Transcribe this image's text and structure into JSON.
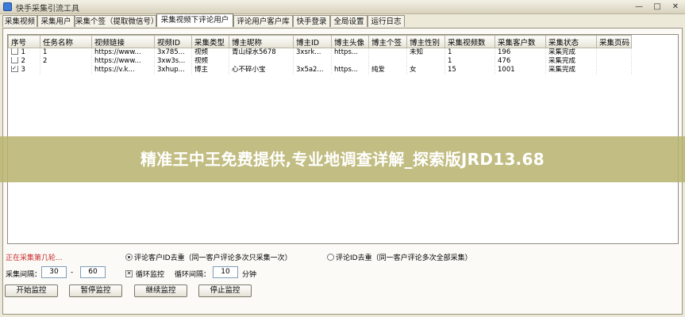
{
  "window": {
    "title": "快手采集引流工具",
    "min": "—",
    "max": "□",
    "close": "✕"
  },
  "tabs": [
    {
      "label": "采集视频"
    },
    {
      "label": "采集用户"
    },
    {
      "label": "采集个签（提取微信号）"
    },
    {
      "label": "采集视频下评论用户"
    },
    {
      "label": "评论用户客户库"
    },
    {
      "label": "快手登录"
    },
    {
      "label": "全局设置"
    },
    {
      "label": "运行日志"
    }
  ],
  "table": {
    "columns": [
      "序号",
      "任务名称",
      "视频链接",
      "视频ID",
      "采集类型",
      "博主昵称",
      "博主ID",
      "博主头像",
      "博主个签",
      "博主性别",
      "采集视频数",
      "采集客户数",
      "采集状态",
      "采集页码"
    ],
    "rows": [
      {
        "checked": false,
        "cells": [
          "1",
          "1",
          "https://www...",
          "3x785...",
          "视频",
          "青山绿水5678",
          "3xsrk...",
          "https...",
          "",
          "未知",
          "1",
          "196",
          "采集完成",
          ""
        ]
      },
      {
        "checked": false,
        "cells": [
          "2",
          "2",
          "https://www...",
          "3xw3s...",
          "视频",
          "",
          "",
          "",
          "",
          "",
          "1",
          "476",
          "采集完成",
          ""
        ]
      },
      {
        "checked": true,
        "cells": [
          "3",
          "",
          "https://v.k...",
          "3xhup...",
          "博主",
          "心不碎小宝",
          "3x5a2...",
          "https...",
          "纯爱",
          "女",
          "15",
          "1001",
          "采集完成",
          ""
        ]
      }
    ]
  },
  "banner": {
    "text": "精准王中王免费提供,专业地调查详解_探索版JRD13.68"
  },
  "controls": {
    "status": "正在采集第几轮...",
    "option1": "评论客户ID去重（同一客户评论多次只采集一次）",
    "option2": "评论ID去重（同一客户评论多次全部采集）",
    "interval_label": "采集间隔：",
    "interval_from": "30",
    "interval_dash": "-",
    "interval_to": "60",
    "loop_label": "循环监控",
    "loop_interval_label": "循环间隔：",
    "loop_interval": "10",
    "minutes": "分钟",
    "btn_start": "开始监控",
    "btn_pause": "暂停监控",
    "btn_resume": "继续监控",
    "btn_stop": "停止监控"
  }
}
